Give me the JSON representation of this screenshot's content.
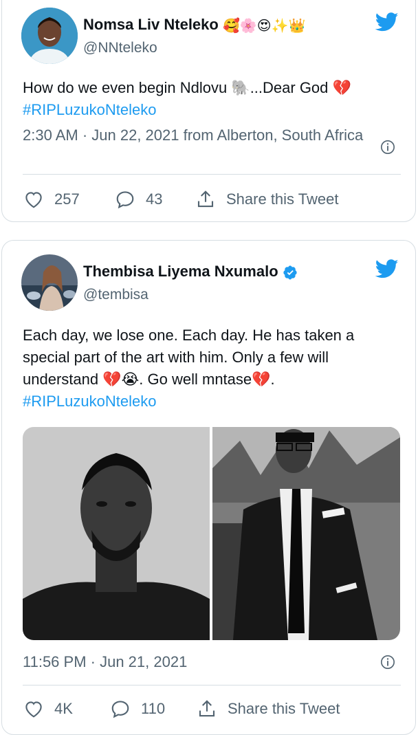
{
  "tweets": [
    {
      "name": "Nomsa Liv Nteleko",
      "handle": "@NNteleko",
      "text": "How do we even begin Ndlovu 🐘...Dear God 💔",
      "hashtag": "#RIPLuzukoNteleko",
      "meta": "2:30 AM · Jun 22, 2021 from Alberton, South Africa",
      "likes": "257",
      "replies": "43",
      "share": "Share this Tweet"
    },
    {
      "name": "Thembisa Liyema Nxumalo",
      "handle": "@tembisa",
      "text": "Each day, we lose one. Each day. He has taken a special part of the art with him. Only a few will understand 💔😭. Go well mntase💔.",
      "hashtag": "#RIPLuzukoNteleko",
      "meta": "11:56 PM · Jun 21, 2021",
      "likes": "4K",
      "replies": "110",
      "share": "Share this Tweet"
    }
  ],
  "colors": {
    "accent": "#1d9bf0",
    "text": "#0f1419",
    "muted": "#536471",
    "border": "#d6dde2"
  }
}
